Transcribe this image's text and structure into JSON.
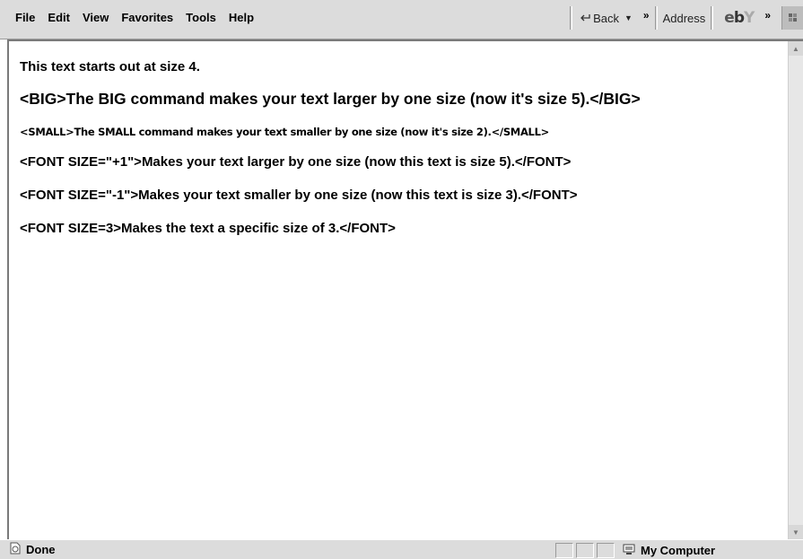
{
  "menu": [
    "File",
    "Edit",
    "View",
    "Favorites",
    "Tools",
    "Help"
  ],
  "toolbar": {
    "back_label": "Back",
    "address_label": "Address",
    "ebay": {
      "e": "e",
      "b": "b",
      "y": "Y"
    }
  },
  "content": {
    "lines": [
      "This text starts out at size 4.",
      "<BIG>The BIG command makes your text larger by one size (now it's size 5).</BIG>",
      "<SMALL>The SMALL command makes your text smaller by one size (now it's size 2).</SMALL>",
      "<FONT SIZE=\"+1\">Makes your text larger by one size (now this text is size 5).</FONT>",
      "<FONT SIZE=\"-1\">Makes your text smaller by one size (now this text is size 3).</FONT>",
      "<FONT SIZE=3>Makes the text a specific size of 3.</FONT>"
    ]
  },
  "status": {
    "text": "Done",
    "zone": "My Computer"
  },
  "colors": {
    "chrome": "#dcdcdc",
    "page_bg": "#ffffff",
    "text": "#000000"
  }
}
